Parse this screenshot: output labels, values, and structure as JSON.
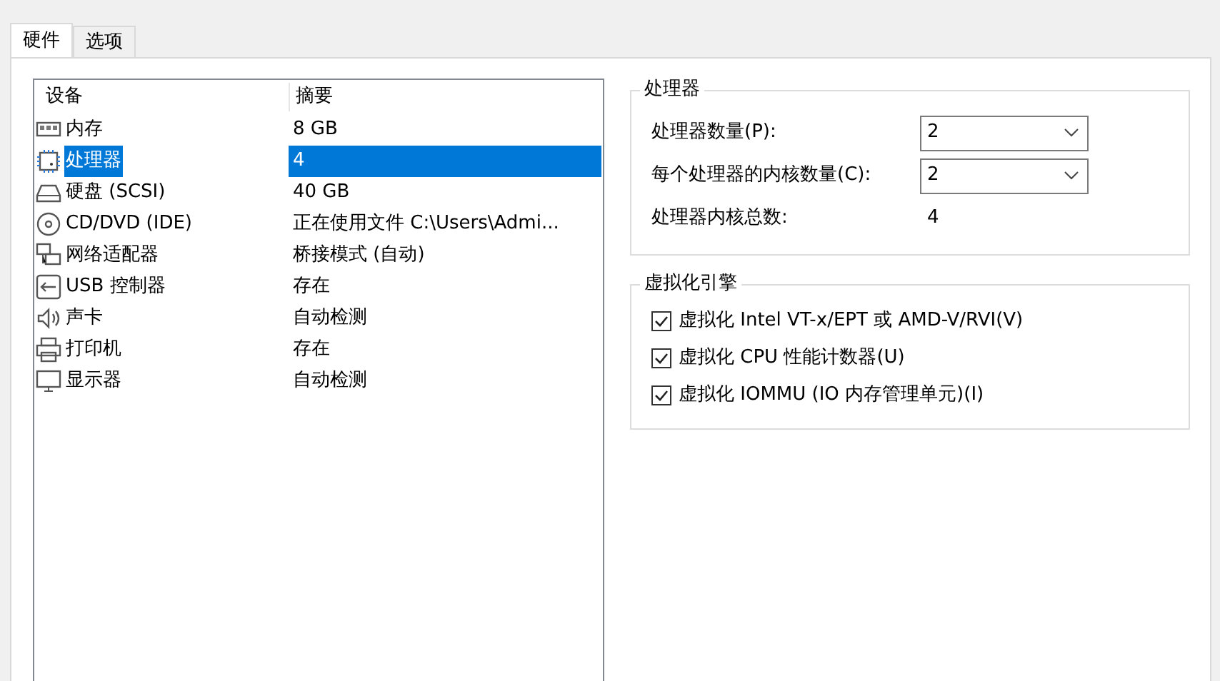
{
  "tabs": [
    {
      "label": "硬件",
      "selected": true
    },
    {
      "label": "选项",
      "selected": false
    }
  ],
  "devices": {
    "columns": [
      "设备",
      "摘要"
    ],
    "rows": [
      {
        "kind": "memory",
        "name": "内存",
        "summary": "8 GB",
        "selected": false
      },
      {
        "kind": "cpu",
        "name": "处理器",
        "summary": "4",
        "selected": true
      },
      {
        "kind": "disk",
        "name": "硬盘 (SCSI)",
        "summary": "40 GB",
        "selected": false
      },
      {
        "kind": "cdrom",
        "name": "CD/DVD (IDE)",
        "summary": "正在使用文件 C:\\Users\\Admi...",
        "selected": false
      },
      {
        "kind": "network",
        "name": "网络适配器",
        "summary": "桥接模式 (自动)",
        "selected": false
      },
      {
        "kind": "usb",
        "name": "USB 控制器",
        "summary": "存在",
        "selected": false
      },
      {
        "kind": "sound",
        "name": "声卡",
        "summary": "自动检测",
        "selected": false
      },
      {
        "kind": "printer",
        "name": "打印机",
        "summary": "存在",
        "selected": false
      },
      {
        "kind": "display",
        "name": "显示器",
        "summary": "自动检测",
        "selected": false
      }
    ]
  },
  "processor": {
    "title": "处理器",
    "fields": [
      {
        "label": "处理器数量(P):",
        "value": "2"
      },
      {
        "label": "每个处理器的内核数量(C):",
        "value": "2"
      }
    ],
    "total": {
      "label": "处理器内核总数:",
      "value": "4"
    }
  },
  "virtualization": {
    "title": "虚拟化引擎",
    "options": [
      {
        "label": "虚拟化 Intel VT-x/EPT 或 AMD-V/RVI(V)",
        "checked": true
      },
      {
        "label": "虚拟化 CPU 性能计数器(U)",
        "checked": true
      },
      {
        "label": "虚拟化 IOMMU (IO 内存管理单元)(I)",
        "checked": true
      }
    ]
  }
}
